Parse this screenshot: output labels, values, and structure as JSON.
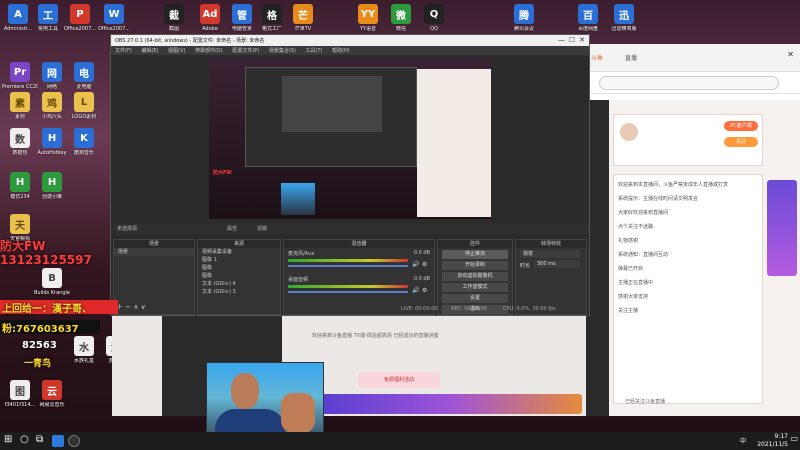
{
  "desktop": {
    "icons": [
      {
        "label": "Administr...",
        "glyph": "A"
      },
      {
        "label": "常用工具",
        "glyph": "工"
      },
      {
        "label": "Office2007...",
        "glyph": "P"
      },
      {
        "label": "Office2007...",
        "glyph": "W"
      },
      {
        "label": "截图",
        "glyph": "截"
      },
      {
        "label": "Adobe",
        "glyph": "Ad"
      },
      {
        "label": "电脑管家",
        "glyph": "管"
      },
      {
        "label": "格式工厂",
        "glyph": "格"
      },
      {
        "label": "芒果TV",
        "glyph": "芒"
      },
      {
        "label": "YY语音",
        "glyph": "YY"
      },
      {
        "label": "微信",
        "glyph": "微"
      },
      {
        "label": "QQ",
        "glyph": "Q"
      },
      {
        "label": "腾讯会议",
        "glyph": "腾"
      },
      {
        "label": "百度网盘",
        "glyph": "百"
      },
      {
        "label": "迅雷精简版",
        "glyph": "迅"
      },
      {
        "label": "Premiere CC2019",
        "glyph": "Pr"
      },
      {
        "label": "网络",
        "glyph": "网"
      },
      {
        "label": "此电脑",
        "glyph": "电"
      },
      {
        "label": "素材",
        "glyph": "素"
      },
      {
        "label": "小鸡尺头",
        "glyph": "鸡"
      },
      {
        "label": "LOGO素材",
        "glyph": "L"
      },
      {
        "label": "数据包",
        "glyph": "数"
      },
      {
        "label": "AutoHotkey",
        "glyph": "H"
      },
      {
        "label": "酷狗音乐",
        "glyph": "K"
      },
      {
        "label": "模仿234",
        "glyph": "H"
      },
      {
        "label": "创建引擎",
        "glyph": "H"
      },
      {
        "label": "天官赐福",
        "glyph": "天"
      },
      {
        "label": "Builds Krangle...",
        "glyph": "B"
      },
      {
        "label": "水族礼盒",
        "glyph": "水"
      },
      {
        "label": "游戏ID",
        "glyph": "游"
      },
      {
        "label": "f3401f314...",
        "glyph": "图"
      },
      {
        "label": "网易云音乐",
        "glyph": "云"
      }
    ]
  },
  "overlay": {
    "line1": "防大FW",
    "phone": "13123125597",
    "banner1": "上回给一：漢子哥、",
    "qq_label": "粉:",
    "qq_number": "767603637",
    "code": "82563",
    "nickname": "一青鸟"
  },
  "obs": {
    "title": "OBS 27.0.1 (64-bit, windows) - 配置文件: 未命名 - 场景: 未命名",
    "menu": [
      "文件(F)",
      "编辑(E)",
      "视图(V)",
      "停靠部件(D)",
      "配置文件(P)",
      "场景集合(S)",
      "工具(T)",
      "帮助(H)"
    ],
    "no_source_label": "未选择源",
    "properties_btn": "属性",
    "filters_btn": "滤镜",
    "docks": {
      "scenes": {
        "header": "场景",
        "items": [
          "场景"
        ]
      },
      "sources": {
        "header": "来源",
        "items": [
          "视频采集设备",
          "图像 1",
          "图像",
          "图像",
          "文本 (GDI+) 4",
          "文本 (GDI+) 3"
        ]
      },
      "mixer": {
        "header": "混音器",
        "tracks": [
          {
            "name": "麦克风/Aux",
            "db": "0.0 dB"
          },
          {
            "name": "桌面音频",
            "db": "0.0 dB"
          }
        ]
      },
      "transitions": {
        "header": "转场特效",
        "type": "渐变",
        "duration_label": "时长",
        "duration": "300 ms"
      },
      "controls": {
        "header": "控件",
        "buttons": [
          "停止推流",
          "开始录制",
          "启动虚拟摄像机",
          "工作室模式",
          "设置",
          "退出"
        ]
      }
    },
    "status": {
      "live": "LIVE: 00:00:00",
      "rec": "REC: 00:00:00",
      "cpu": "CPU: 0.0%, 30.00 fps"
    }
  },
  "browser": {
    "tabs": [
      "斗鱼",
      "直播"
    ],
    "chat": [
      "欢迎来到本直播间，斗鱼严禁未成年人直播或打赏",
      "系统提示：主播在线时间请文明发言",
      "大家好欢迎来到直播间",
      "点个关注不迷路",
      "礼物感谢",
      "系统通知：直播间互动",
      "弹幕已开启",
      "主播正在直播中",
      "感谢大家支持",
      "关注主播"
    ],
    "pc_btn": "PC客户端",
    "follow": "关注",
    "bottom_text": "已经关注斗鱼直播"
  },
  "midpage": {
    "banner_text": "欢迎来到斗鱼直播 TV端-体验超高清 已经成功的直播讲座",
    "promo": "免费福利活动"
  },
  "taskbar": {
    "time": "9:17",
    "date": "2021/11/5",
    "lang": "中"
  },
  "colors": {
    "accent": "#e06b2a",
    "obs_bg": "#2b2b2b",
    "overlay_red": "#ff3b3b",
    "overlay_yellow": "#ffdc2e"
  }
}
